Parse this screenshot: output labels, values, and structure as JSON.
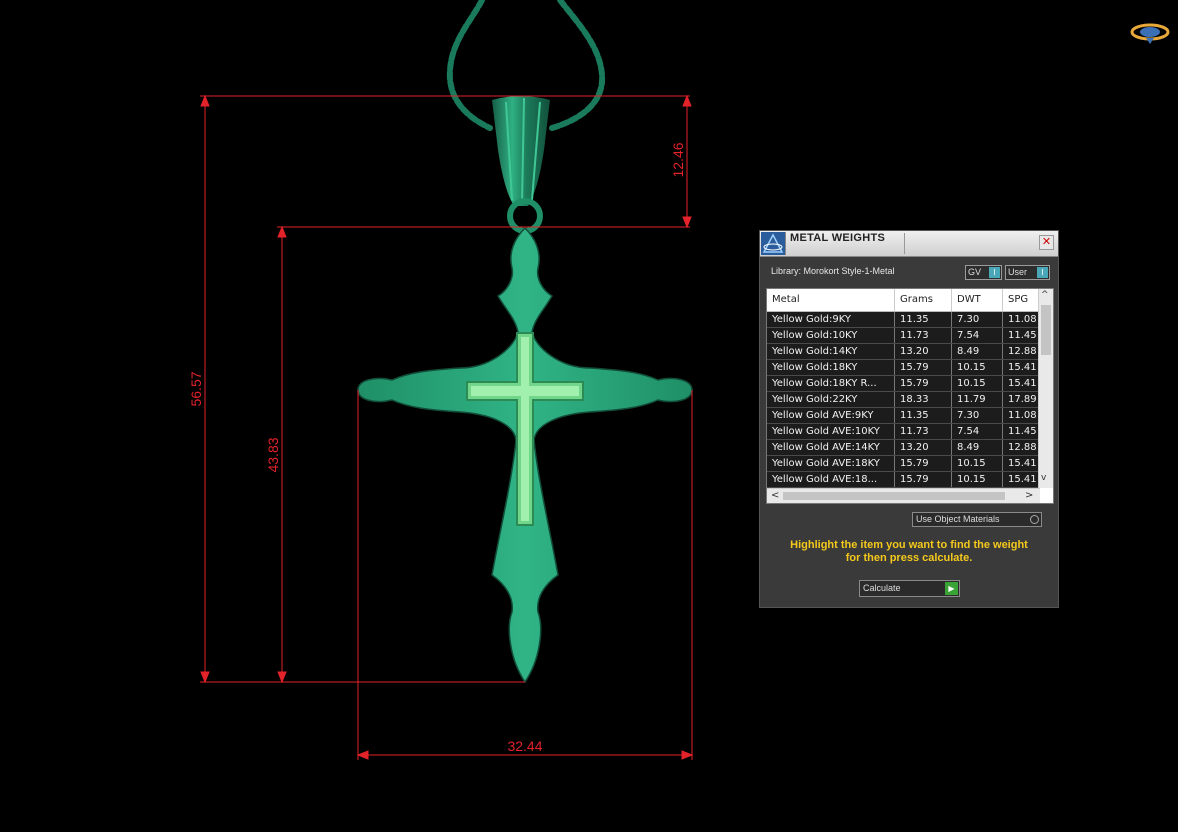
{
  "colors": {
    "background": "#000000",
    "dimension": "#e3222a",
    "model_green": "#2ba57a",
    "inner_cross": "#7fdc8c",
    "panel_bg": "#3a3a3a",
    "hint_yellow": "#f4c91c"
  },
  "viewport": {
    "dimensions": {
      "total_height": "56.57",
      "body_height": "43.83",
      "bail_height": "12.46",
      "width": "32.44"
    },
    "corner_logo_icon": "orbit-logo-icon"
  },
  "panel": {
    "title": "METAL WEIGHTS",
    "close_label": "✕",
    "library": "Library: Morokort Style-1-Metal",
    "gv_label": "GV",
    "gv_indicator": "I",
    "user_label": "User",
    "user_indicator": "I",
    "columns": [
      "Metal",
      "Grams",
      "DWT",
      "SPG"
    ],
    "rows": [
      {
        "metal": "Yellow Gold:9KY",
        "grams": "11.35",
        "dwt": "7.30",
        "spg": "11.08"
      },
      {
        "metal": "Yellow Gold:10KY",
        "grams": "11.73",
        "dwt": "7.54",
        "spg": "11.45"
      },
      {
        "metal": "Yellow Gold:14KY",
        "grams": "13.20",
        "dwt": "8.49",
        "spg": "12.88"
      },
      {
        "metal": "Yellow Gold:18KY",
        "grams": "15.79",
        "dwt": "10.15",
        "spg": "15.41"
      },
      {
        "metal": "Yellow Gold:18KY R...",
        "grams": "15.79",
        "dwt": "10.15",
        "spg": "15.41"
      },
      {
        "metal": "Yellow Gold:22KY",
        "grams": "18.33",
        "dwt": "11.79",
        "spg": "17.89"
      },
      {
        "metal": "Yellow Gold AVE:9KY",
        "grams": "11.35",
        "dwt": "7.30",
        "spg": "11.08"
      },
      {
        "metal": "Yellow Gold AVE:10KY",
        "grams": "11.73",
        "dwt": "7.54",
        "spg": "11.45"
      },
      {
        "metal": "Yellow Gold AVE:14KY",
        "grams": "13.20",
        "dwt": "8.49",
        "spg": "12.88"
      },
      {
        "metal": "Yellow Gold AVE:18KY",
        "grams": "15.79",
        "dwt": "10.15",
        "spg": "15.41"
      },
      {
        "metal": "Yellow Gold AVE:18...",
        "grams": "15.79",
        "dwt": "10.15",
        "spg": "15.41"
      }
    ],
    "scroll_up": "^",
    "scroll_down": "v",
    "scroll_left": "<",
    "scroll_right": ">",
    "use_object_materials": "Use Object Materials",
    "hint_line1": "Highlight the item you want to find the weight",
    "hint_line2": "for then press calculate.",
    "calculate_label": "Calculate",
    "calculate_icon": "play-arrow-icon"
  }
}
